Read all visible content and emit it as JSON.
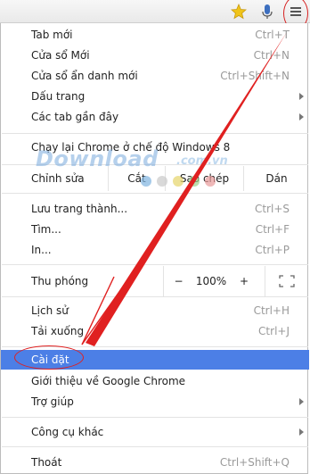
{
  "toolbar": {
    "star_icon": "star-icon",
    "mic_icon": "microphone-icon",
    "menu_icon": "hamburger-menu-icon"
  },
  "menu": {
    "new_tab": {
      "label": "Tab mới",
      "shortcut": "Ctrl+T"
    },
    "new_window": {
      "label": "Cửa sổ Mới",
      "shortcut": "Ctrl+N"
    },
    "incognito": {
      "label": "Cửa sổ ẩn danh mới",
      "shortcut": "Ctrl+Shift+N"
    },
    "bookmarks": {
      "label": "Dấu trang"
    },
    "recent_tabs": {
      "label": "Các tab gần đây"
    },
    "relaunch": {
      "label": "Chạy lại Chrome ở chế độ Windows 8"
    },
    "edit": {
      "label": "Chỉnh sửa",
      "cut": "Cắt",
      "copy": "Sao chép",
      "paste": "Dán"
    },
    "save_page": {
      "label": "Lưu trang thành...",
      "shortcut": "Ctrl+S"
    },
    "find": {
      "label": "Tìm...",
      "shortcut": "Ctrl+F"
    },
    "print": {
      "label": "In...",
      "shortcut": "Ctrl+P"
    },
    "zoom": {
      "label": "Thu phóng",
      "minus": "−",
      "level": "100%",
      "plus": "+"
    },
    "history": {
      "label": "Lịch sử",
      "shortcut": "Ctrl+H"
    },
    "downloads": {
      "label": "Tải xuống",
      "shortcut": "Ctrl+J"
    },
    "settings": {
      "label": "Cài đặt"
    },
    "about": {
      "label": "Giới thiệu về Google Chrome"
    },
    "help": {
      "label": "Trợ giúp"
    },
    "more_tools": {
      "label": "Công cụ khác"
    },
    "exit": {
      "label": "Thoát",
      "shortcut": "Ctrl+Shift+Q"
    }
  },
  "watermark": {
    "text": "Download",
    "sub": ".com.vn"
  },
  "colors": {
    "selected": "#4c7fe6",
    "annotation": "#e02020",
    "star": "#f0c419",
    "mic": "#3d6fbf"
  }
}
